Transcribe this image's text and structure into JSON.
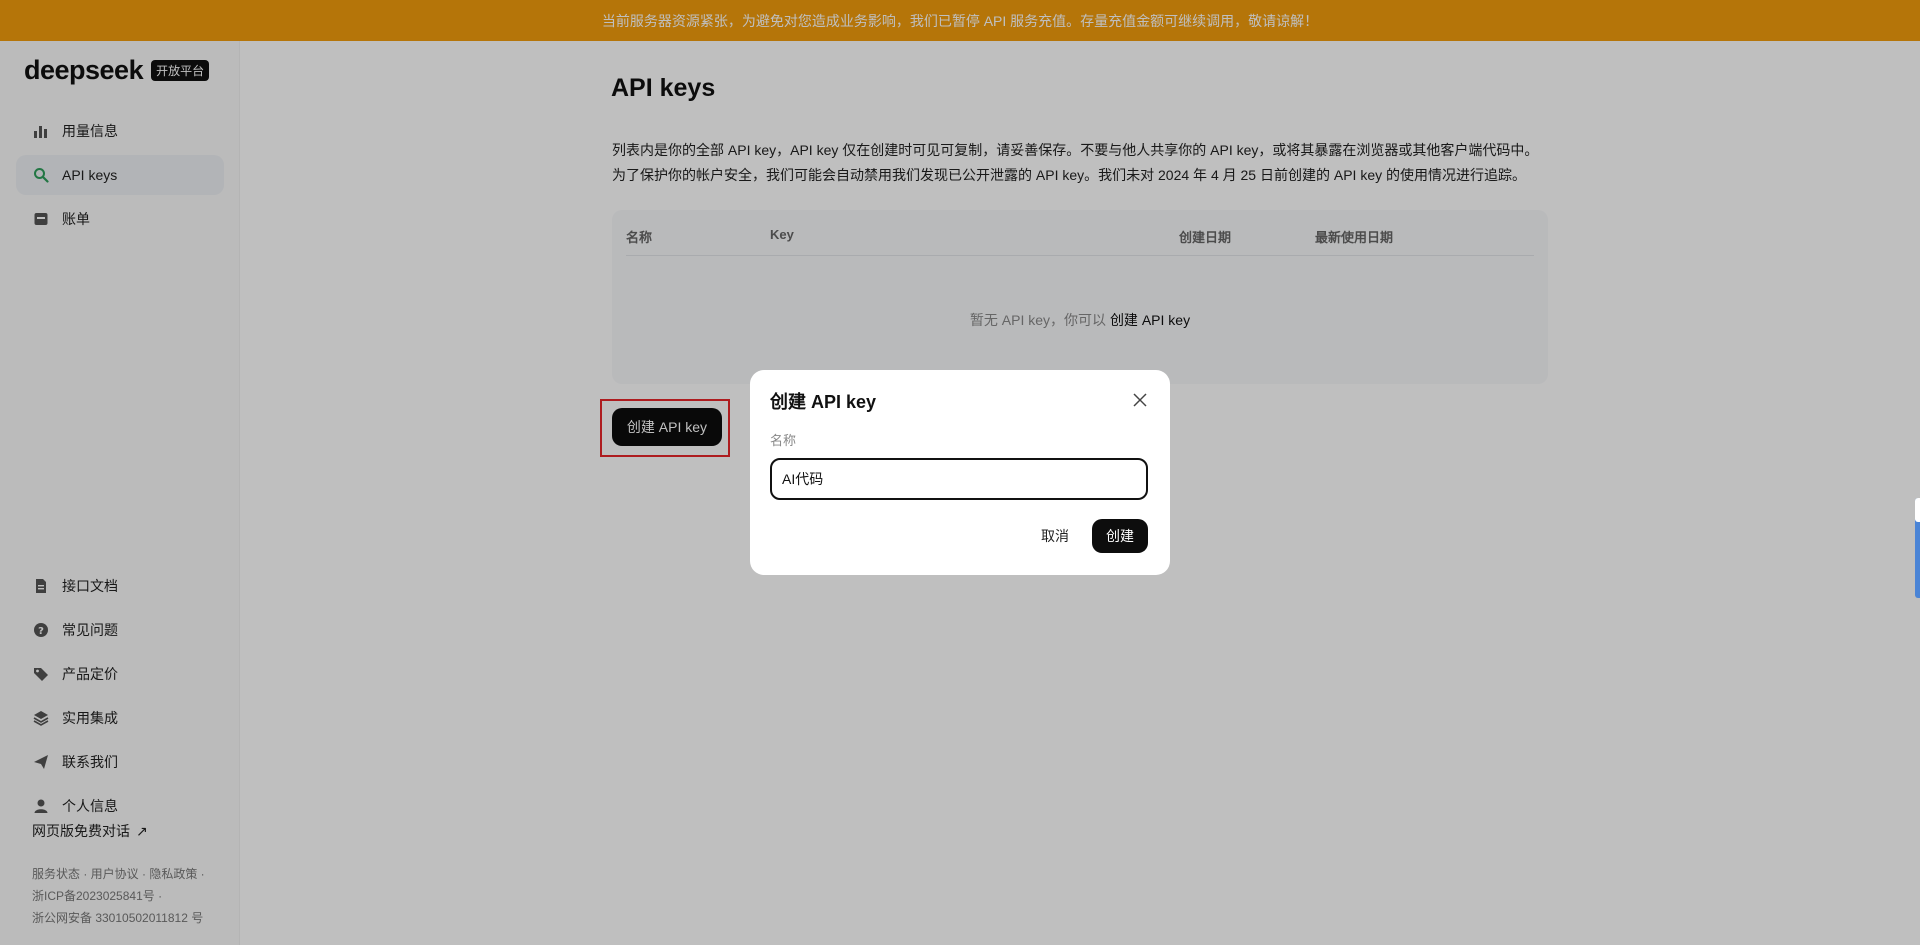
{
  "banner": {
    "text": "当前服务器资源紧张，为避免对您造成业务影响，我们已暂停 API 服务充值。存量充值金额可继续调用，敬请谅解！"
  },
  "brand": {
    "name": "deepseek",
    "badge": "开放平台"
  },
  "sidebar": {
    "top_items": [
      {
        "label": "用量信息",
        "icon": "bar-chart-icon"
      },
      {
        "label": "API keys",
        "icon": "search-icon",
        "active": true
      },
      {
        "label": "账单",
        "icon": "wallet-icon"
      }
    ],
    "bottom_items": [
      {
        "label": "接口文档",
        "icon": "document-icon"
      },
      {
        "label": "常见问题",
        "icon": "question-icon"
      },
      {
        "label": "产品定价",
        "icon": "tag-icon"
      },
      {
        "label": "实用集成",
        "icon": "layers-icon"
      },
      {
        "label": "联系我们",
        "icon": "send-icon"
      },
      {
        "label": "个人信息",
        "icon": "user-icon"
      }
    ],
    "web_chat": "网页版免费对话",
    "footer": {
      "line1": "服务状态 · 用户协议 · 隐私政策 ·",
      "line2": "浙ICP备2023025841号 ·",
      "line3": "浙公网安备 33010502011812 号"
    }
  },
  "main": {
    "title": "API keys",
    "desc_line1": "列表内是你的全部 API key，API key 仅在创建时可见可复制，请妥善保存。不要与他人共享你的 API key，或将其暴露在浏览器或其他客户端代码中。",
    "desc_line2": "为了保护你的帐户安全，我们可能会自动禁用我们发现已公开泄露的 API key。我们未对 2024 年 4 月 25 日前创建的 API key 的使用情况进行追踪。",
    "table": {
      "columns": [
        "名称",
        "Key",
        "创建日期",
        "最新使用日期"
      ],
      "empty_prefix": "暂无 API key，你可以",
      "empty_link": "创建 API key"
    },
    "create_button": "创建 API key"
  },
  "modal": {
    "title": "创建 API key",
    "name_label": "名称",
    "name_value": "AI代码",
    "cancel": "取消",
    "create": "创建"
  },
  "colors": {
    "banner": "#f29c0c",
    "accent_green": "#2e9e5b",
    "highlight_red": "#e8262a",
    "primary_black": "#0d0d0d"
  }
}
